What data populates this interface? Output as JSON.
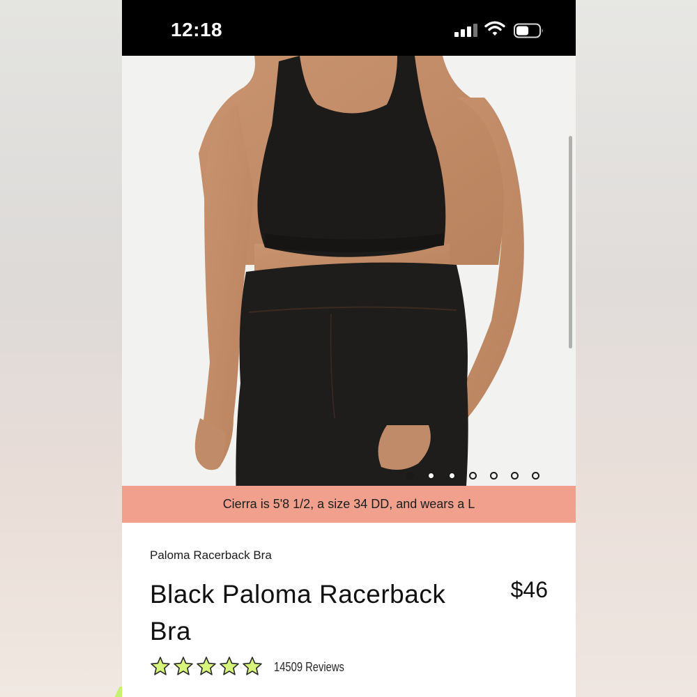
{
  "status_bar": {
    "time": "12:18",
    "signal_icon": "cellular-signal-icon",
    "wifi_icon": "wifi-icon",
    "battery_icon": "battery-icon",
    "battery_level": 0.55
  },
  "gallery": {
    "image": "product-photo-model-wearing-black-bra-and-leggings",
    "slide_count": 7,
    "current_slide": 1,
    "caption": "Cierra is 5'8 1/2, a size 34 DD, and wears a L"
  },
  "product": {
    "collection_name": "Paloma Racerback Bra",
    "title": "Black Paloma Racerback Bra",
    "price": "$46",
    "rating": 5,
    "rating_max": 5,
    "reviews_label": "14509 Reviews",
    "star_color": "#d7f57a"
  },
  "colors": {
    "caption_bg": "#f0a08c",
    "status_bar_bg": "#000000"
  }
}
